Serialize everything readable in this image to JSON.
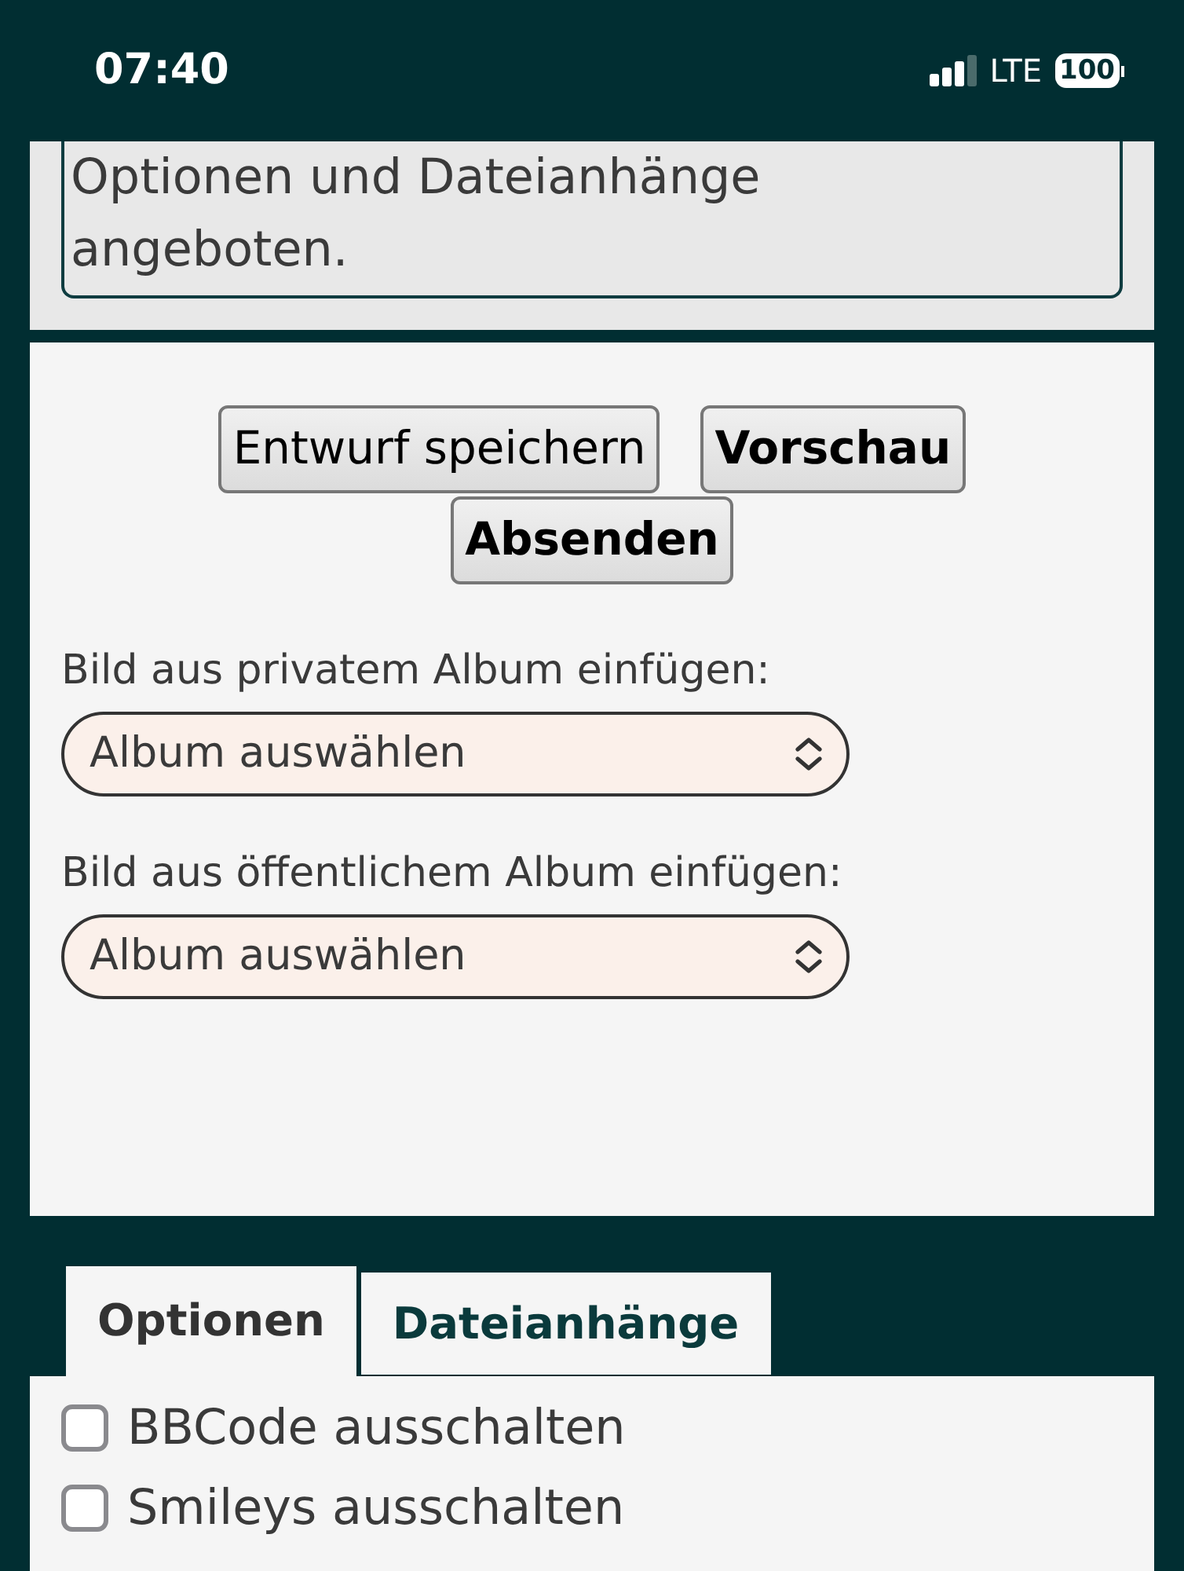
{
  "status_bar": {
    "time": "07:40",
    "network": "LTE",
    "battery": "100"
  },
  "message_box": {
    "lines": [
      "Optionen und Dateianhänge",
      "angeboten."
    ]
  },
  "buttons": [
    {
      "label": "Entwurf speichern",
      "primary": false
    },
    {
      "label": "Vorschau",
      "primary": true
    },
    {
      "label": "Absenden",
      "primary": true
    }
  ],
  "album_selects": [
    {
      "label": "Bild aus privatem Album einfügen:",
      "value": "Album auswählen"
    },
    {
      "label": "Bild aus öffentlichem Album einfügen:",
      "value": "Album auswählen"
    }
  ],
  "tabs": [
    {
      "label": "Optionen",
      "selected": true
    },
    {
      "label": "Dateianhänge",
      "selected": false
    }
  ],
  "options": [
    {
      "label": "BBCode ausschalten",
      "checked": false
    },
    {
      "label": "Smileys ausschalten",
      "checked": false
    }
  ]
}
